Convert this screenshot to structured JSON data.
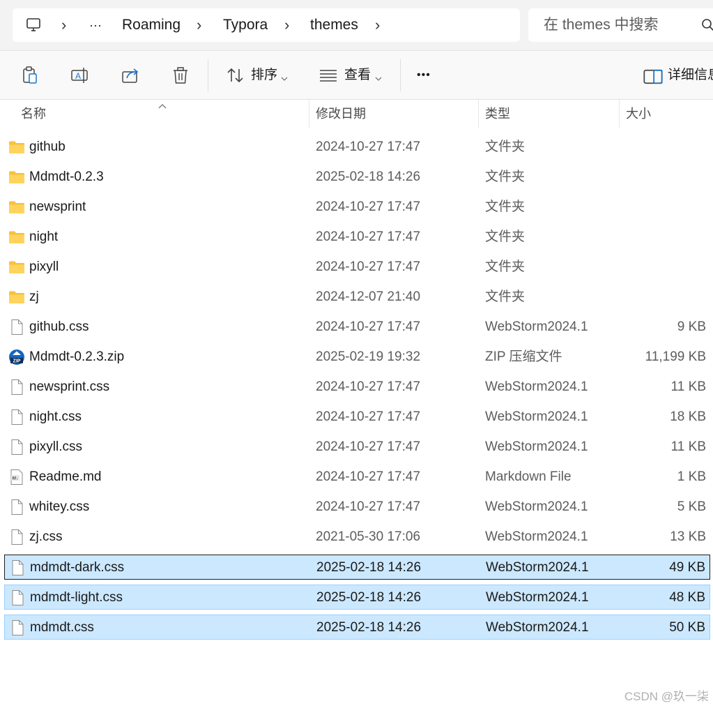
{
  "address": {
    "crumbs": [
      "Roaming",
      "Typora",
      "themes"
    ],
    "overflow": "···",
    "search_placeholder": "在 themes 中搜索"
  },
  "toolbar": {
    "sort_label": "排序",
    "view_label": "查看",
    "more_label": "•••",
    "details_label": "详细信息"
  },
  "columns": {
    "name": "名称",
    "date": "修改日期",
    "type": "类型",
    "size": "大小"
  },
  "files": [
    {
      "name": "github",
      "date": "2024-10-27 17:47",
      "type": "文件夹",
      "size": "",
      "icon": "folder-icon"
    },
    {
      "name": "Mdmdt-0.2.3",
      "date": "2025-02-18 14:26",
      "type": "文件夹",
      "size": "",
      "icon": "folder-icon"
    },
    {
      "name": "newsprint",
      "date": "2024-10-27 17:47",
      "type": "文件夹",
      "size": "",
      "icon": "folder-icon"
    },
    {
      "name": "night",
      "date": "2024-10-27 17:47",
      "type": "文件夹",
      "size": "",
      "icon": "folder-icon"
    },
    {
      "name": "pixyll",
      "date": "2024-10-27 17:47",
      "type": "文件夹",
      "size": "",
      "icon": "folder-icon"
    },
    {
      "name": "zj",
      "date": "2024-12-07 21:40",
      "type": "文件夹",
      "size": "",
      "icon": "folder-icon"
    },
    {
      "name": "github.css",
      "date": "2024-10-27 17:47",
      "type": "WebStorm2024.1",
      "size": "9 KB",
      "icon": "file-icon"
    },
    {
      "name": "Mdmdt-0.2.3.zip",
      "date": "2025-02-19 19:32",
      "type": "ZIP 压缩文件",
      "size": "11,199 KB",
      "icon": "zip-icon"
    },
    {
      "name": "newsprint.css",
      "date": "2024-10-27 17:47",
      "type": "WebStorm2024.1",
      "size": "11 KB",
      "icon": "file-icon"
    },
    {
      "name": "night.css",
      "date": "2024-10-27 17:47",
      "type": "WebStorm2024.1",
      "size": "18 KB",
      "icon": "file-icon"
    },
    {
      "name": "pixyll.css",
      "date": "2024-10-27 17:47",
      "type": "WebStorm2024.1",
      "size": "11 KB",
      "icon": "file-icon"
    },
    {
      "name": "Readme.md",
      "date": "2024-10-27 17:47",
      "type": "Markdown File",
      "size": "1 KB",
      "icon": "markdown-icon"
    },
    {
      "name": "whitey.css",
      "date": "2024-10-27 17:47",
      "type": "WebStorm2024.1",
      "size": "5 KB",
      "icon": "file-icon"
    },
    {
      "name": "zj.css",
      "date": "2021-05-30 17:06",
      "type": "WebStorm2024.1",
      "size": "13 KB",
      "icon": "file-icon"
    },
    {
      "name": "mdmdt-dark.css",
      "date": "2025-02-18 14:26",
      "type": "WebStorm2024.1",
      "size": "49 KB",
      "icon": "file-icon",
      "selected": true,
      "focused": true
    },
    {
      "name": "mdmdt-light.css",
      "date": "2025-02-18 14:26",
      "type": "WebStorm2024.1",
      "size": "48 KB",
      "icon": "file-icon",
      "selected": true
    },
    {
      "name": "mdmdt.css",
      "date": "2025-02-18 14:26",
      "type": "WebStorm2024.1",
      "size": "50 KB",
      "icon": "file-icon",
      "selected": true
    }
  ],
  "colors": {
    "selection": "#cce8ff",
    "selection_border": "#99d1ff",
    "folder": "#f8c13c"
  },
  "watermark": "CSDN @玖一柒"
}
